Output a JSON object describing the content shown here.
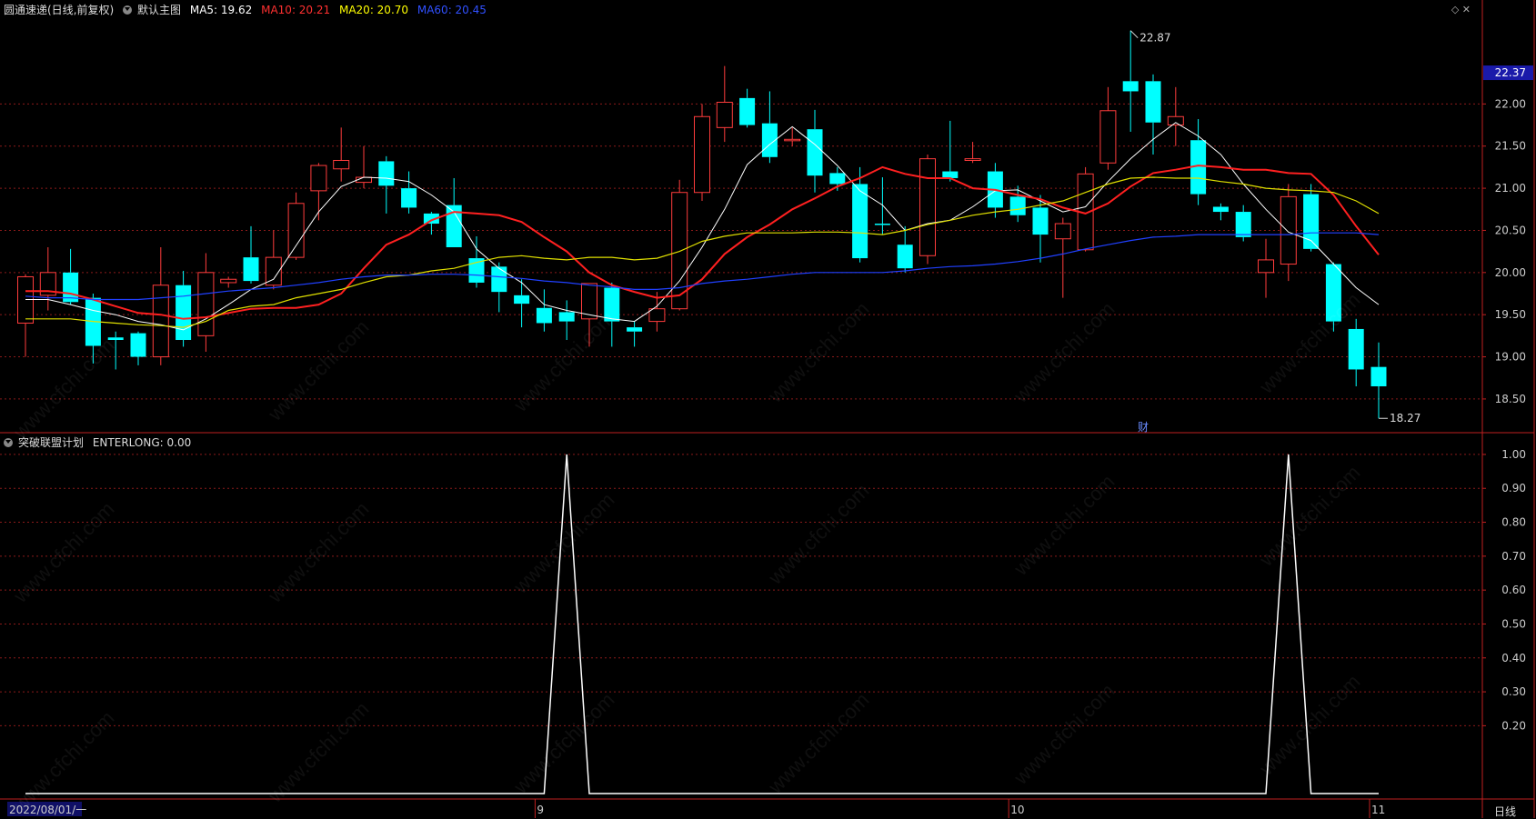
{
  "header": {
    "stock": "圆通速递(日线,前复权)",
    "main_label": "默认主图",
    "ma5": "MA5: 19.62",
    "ma10": "MA10: 20.21",
    "ma20": "MA20: 20.70",
    "ma60": "MA60: 20.45",
    "icons": "◇ ✕"
  },
  "indicator": {
    "name": "突破联盟计划",
    "value": "ENTERLONG: 0.00"
  },
  "badge": "财",
  "period_label": "日线",
  "watermark": "www.cfchi.com",
  "colors": {
    "up": "#ff3c3c",
    "down": "#00ffff",
    "ma5": "#ffffff",
    "ma10": "#ff2020",
    "ma20": "#e0e000",
    "ma60": "#2040ff",
    "grid": "#8b1a1a",
    "axis_text": "#ccc",
    "price_tag_bg": "#1a1aaa"
  },
  "chart_data": [
    {
      "type": "candlestick",
      "title": "圆通速递(日线,前复权)",
      "ylim": [
        18.1,
        23.05
      ],
      "y_ticks": [
        18.5,
        19.0,
        19.5,
        20.0,
        20.5,
        21.0,
        21.5,
        22.0
      ],
      "y_tick_labels": [
        "18.50",
        "19.00",
        "19.50",
        "20.00",
        "20.50",
        "21.00",
        "21.50",
        "22.00"
      ],
      "current_price": "22.37",
      "current_price_value": 22.37,
      "high_label": "22.87",
      "low_label": "18.27",
      "x_labels": [
        {
          "index": 0,
          "text": "2022/08/01/一"
        },
        {
          "index": 23,
          "text": "9"
        },
        {
          "index": 44,
          "text": "10"
        },
        {
          "index": 60,
          "text": "11"
        }
      ],
      "candles": [
        {
          "o": 19.4,
          "h": 19.98,
          "l": 19.0,
          "c": 19.95
        },
        {
          "o": 19.73,
          "h": 20.3,
          "l": 19.55,
          "c": 20.0
        },
        {
          "o": 20.0,
          "h": 20.28,
          "l": 19.62,
          "c": 19.65
        },
        {
          "o": 19.7,
          "h": 19.75,
          "l": 18.92,
          "c": 19.13
        },
        {
          "o": 19.23,
          "h": 19.3,
          "l": 18.85,
          "c": 19.2
        },
        {
          "o": 19.28,
          "h": 19.3,
          "l": 18.9,
          "c": 19.0
        },
        {
          "o": 19.0,
          "h": 20.3,
          "l": 18.9,
          "c": 19.85
        },
        {
          "o": 19.85,
          "h": 20.02,
          "l": 19.12,
          "c": 19.2
        },
        {
          "o": 19.25,
          "h": 20.23,
          "l": 19.06,
          "c": 20.0
        },
        {
          "o": 19.88,
          "h": 19.95,
          "l": 19.82,
          "c": 19.92
        },
        {
          "o": 20.18,
          "h": 20.55,
          "l": 19.87,
          "c": 19.9
        },
        {
          "o": 19.85,
          "h": 20.5,
          "l": 19.8,
          "c": 20.18
        },
        {
          "o": 20.18,
          "h": 20.95,
          "l": 20.15,
          "c": 20.82
        },
        {
          "o": 20.97,
          "h": 21.3,
          "l": 20.62,
          "c": 21.27
        },
        {
          "o": 21.23,
          "h": 21.72,
          "l": 21.08,
          "c": 21.33
        },
        {
          "o": 21.07,
          "h": 21.5,
          "l": 21.0,
          "c": 21.13
        },
        {
          "o": 21.32,
          "h": 21.38,
          "l": 20.7,
          "c": 21.03
        },
        {
          "o": 21.0,
          "h": 21.2,
          "l": 20.7,
          "c": 20.77
        },
        {
          "o": 20.7,
          "h": 20.72,
          "l": 20.45,
          "c": 20.58
        },
        {
          "o": 20.8,
          "h": 21.12,
          "l": 20.35,
          "c": 20.3
        },
        {
          "o": 20.17,
          "h": 20.43,
          "l": 19.82,
          "c": 19.88
        },
        {
          "o": 20.07,
          "h": 20.12,
          "l": 19.53,
          "c": 19.77
        },
        {
          "o": 19.73,
          "h": 19.92,
          "l": 19.35,
          "c": 19.63
        },
        {
          "o": 19.58,
          "h": 19.8,
          "l": 19.3,
          "c": 19.4
        },
        {
          "o": 19.53,
          "h": 19.67,
          "l": 19.2,
          "c": 19.42
        },
        {
          "o": 19.45,
          "h": 19.87,
          "l": 19.12,
          "c": 19.87
        },
        {
          "o": 19.82,
          "h": 19.88,
          "l": 19.12,
          "c": 19.42
        },
        {
          "o": 19.35,
          "h": 19.42,
          "l": 19.12,
          "c": 19.3
        },
        {
          "o": 19.42,
          "h": 19.77,
          "l": 19.3,
          "c": 19.57
        },
        {
          "o": 19.57,
          "h": 21.1,
          "l": 19.55,
          "c": 20.95
        },
        {
          "o": 20.95,
          "h": 22.0,
          "l": 20.85,
          "c": 21.85
        },
        {
          "o": 21.72,
          "h": 22.45,
          "l": 21.55,
          "c": 22.02
        },
        {
          "o": 22.07,
          "h": 22.18,
          "l": 21.72,
          "c": 21.75
        },
        {
          "o": 21.77,
          "h": 22.15,
          "l": 21.3,
          "c": 21.37
        },
        {
          "o": 21.58,
          "h": 21.72,
          "l": 21.5,
          "c": 21.58
        },
        {
          "o": 21.7,
          "h": 21.93,
          "l": 20.95,
          "c": 21.15
        },
        {
          "o": 21.18,
          "h": 21.25,
          "l": 20.97,
          "c": 21.05
        },
        {
          "o": 21.05,
          "h": 21.25,
          "l": 20.12,
          "c": 20.17
        },
        {
          "o": 20.58,
          "h": 21.13,
          "l": 20.45,
          "c": 20.57
        },
        {
          "o": 20.33,
          "h": 20.55,
          "l": 20.0,
          "c": 20.05
        },
        {
          "o": 20.2,
          "h": 21.4,
          "l": 20.1,
          "c": 21.35
        },
        {
          "o": 21.2,
          "h": 21.8,
          "l": 21.08,
          "c": 21.12
        },
        {
          "o": 21.33,
          "h": 21.55,
          "l": 21.3,
          "c": 21.35
        },
        {
          "o": 21.2,
          "h": 21.3,
          "l": 20.65,
          "c": 20.77
        },
        {
          "o": 20.9,
          "h": 21.03,
          "l": 20.6,
          "c": 20.68
        },
        {
          "o": 20.77,
          "h": 20.92,
          "l": 20.12,
          "c": 20.45
        },
        {
          "o": 20.4,
          "h": 20.65,
          "l": 19.7,
          "c": 20.58
        },
        {
          "o": 20.27,
          "h": 21.25,
          "l": 20.25,
          "c": 21.17
        },
        {
          "o": 21.3,
          "h": 22.2,
          "l": 21.22,
          "c": 21.92
        },
        {
          "o": 22.27,
          "h": 22.87,
          "l": 21.67,
          "c": 22.15
        },
        {
          "o": 22.27,
          "h": 22.35,
          "l": 21.4,
          "c": 21.78
        },
        {
          "o": 21.75,
          "h": 22.2,
          "l": 21.5,
          "c": 21.85
        },
        {
          "o": 21.57,
          "h": 21.82,
          "l": 20.8,
          "c": 20.93
        },
        {
          "o": 20.78,
          "h": 20.82,
          "l": 20.62,
          "c": 20.72
        },
        {
          "o": 20.72,
          "h": 20.8,
          "l": 20.37,
          "c": 20.42
        },
        {
          "o": 20.0,
          "h": 20.4,
          "l": 19.7,
          "c": 20.15
        },
        {
          "o": 20.1,
          "h": 21.05,
          "l": 19.9,
          "c": 20.9
        },
        {
          "o": 20.93,
          "h": 21.05,
          "l": 20.25,
          "c": 20.28
        },
        {
          "o": 20.1,
          "h": 20.12,
          "l": 19.3,
          "c": 19.42
        },
        {
          "o": 19.33,
          "h": 19.45,
          "l": 18.65,
          "c": 18.85
        },
        {
          "o": 18.88,
          "h": 19.17,
          "l": 18.27,
          "c": 18.65
        }
      ],
      "series": [
        {
          "name": "MA5",
          "values": [
            19.68,
            19.68,
            19.62,
            19.55,
            19.5,
            19.42,
            19.38,
            19.32,
            19.45,
            19.62,
            19.8,
            19.92,
            20.32,
            20.72,
            21.02,
            21.13,
            21.12,
            21.08,
            20.92,
            20.72,
            20.28,
            20.05,
            19.88,
            19.62,
            19.55,
            19.5,
            19.45,
            19.42,
            19.6,
            19.9,
            20.3,
            20.75,
            21.28,
            21.52,
            21.73,
            21.52,
            21.27,
            20.97,
            20.8,
            20.5,
            20.58,
            20.62,
            20.78,
            20.97,
            20.98,
            20.85,
            20.72,
            20.78,
            21.08,
            21.35,
            21.58,
            21.78,
            21.62,
            21.4,
            21.05,
            20.75,
            20.48,
            20.38,
            20.1,
            19.82,
            19.62
          ]
        },
        {
          "name": "MA10",
          "values": [
            19.78,
            19.78,
            19.75,
            19.68,
            19.6,
            19.52,
            19.5,
            19.45,
            19.47,
            19.52,
            19.57,
            19.58,
            19.58,
            19.62,
            19.75,
            20.05,
            20.33,
            20.45,
            20.62,
            20.72,
            20.7,
            20.68,
            20.6,
            20.42,
            20.25,
            20.0,
            19.85,
            19.77,
            19.7,
            19.73,
            19.92,
            20.22,
            20.42,
            20.57,
            20.75,
            20.88,
            21.02,
            21.12,
            21.25,
            21.17,
            21.12,
            21.12,
            21.0,
            20.98,
            20.92,
            20.87,
            20.77,
            20.7,
            20.82,
            21.02,
            21.18,
            21.22,
            21.27,
            21.25,
            21.22,
            21.22,
            21.18,
            21.17,
            20.92,
            20.55,
            20.21
          ]
        },
        {
          "name": "MA20",
          "values": [
            19.45,
            19.45,
            19.45,
            19.42,
            19.4,
            19.38,
            19.37,
            19.35,
            19.42,
            19.55,
            19.6,
            19.62,
            19.7,
            19.75,
            19.8,
            19.88,
            19.95,
            19.97,
            20.02,
            20.05,
            20.12,
            20.18,
            20.2,
            20.17,
            20.15,
            20.18,
            20.18,
            20.15,
            20.17,
            20.25,
            20.37,
            20.43,
            20.47,
            20.47,
            20.47,
            20.48,
            20.48,
            20.47,
            20.45,
            20.5,
            20.57,
            20.62,
            20.68,
            20.72,
            20.75,
            20.8,
            20.85,
            20.95,
            21.05,
            21.12,
            21.13,
            21.12,
            21.12,
            21.08,
            21.05,
            21.0,
            20.98,
            20.97,
            20.95,
            20.85,
            20.7
          ]
        },
        {
          "name": "MA60",
          "values": [
            19.72,
            19.7,
            19.7,
            19.68,
            19.68,
            19.68,
            19.7,
            19.72,
            19.75,
            19.78,
            19.8,
            19.82,
            19.85,
            19.88,
            19.92,
            19.95,
            19.97,
            19.97,
            19.98,
            19.98,
            19.97,
            19.95,
            19.93,
            19.9,
            19.88,
            19.85,
            19.83,
            19.8,
            19.8,
            19.82,
            19.87,
            19.9,
            19.92,
            19.95,
            19.98,
            20.0,
            20.0,
            20.0,
            20.0,
            20.02,
            20.05,
            20.07,
            20.08,
            20.1,
            20.13,
            20.17,
            20.22,
            20.28,
            20.33,
            20.38,
            20.42,
            20.43,
            20.45,
            20.45,
            20.45,
            20.45,
            20.45,
            20.47,
            20.47,
            20.47,
            20.45
          ]
        }
      ]
    },
    {
      "type": "line",
      "title": "突破联盟计划",
      "ylim": [
        0.0,
        1.04
      ],
      "y_ticks": [
        0.2,
        0.3,
        0.4,
        0.5,
        0.6,
        0.7,
        0.8,
        0.9,
        1.0
      ],
      "y_tick_labels": [
        "0.20",
        "0.30",
        "0.40",
        "0.50",
        "0.60",
        "0.70",
        "0.80",
        "0.90",
        "1.00"
      ],
      "series": [
        {
          "name": "ENTERLONG",
          "values": [
            0,
            0,
            0,
            0,
            0,
            0,
            0,
            0,
            0,
            0,
            0,
            0,
            0,
            0,
            0,
            0,
            0,
            0,
            0,
            0,
            0,
            0,
            0,
            0,
            1,
            0,
            0,
            0,
            0,
            0,
            0,
            0,
            0,
            0,
            0,
            0,
            0,
            0,
            0,
            0,
            0,
            0,
            0,
            0,
            0,
            0,
            0,
            0,
            0,
            0,
            0,
            0,
            0,
            0,
            0,
            0,
            1,
            0,
            0,
            0,
            0
          ]
        }
      ]
    }
  ]
}
